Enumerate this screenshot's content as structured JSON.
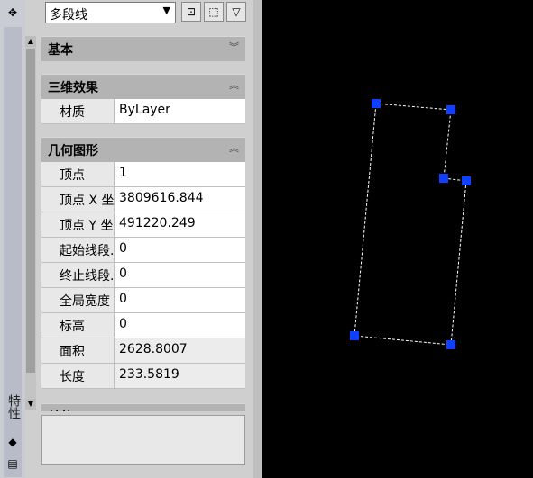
{
  "palette": {
    "vertical_title": "特性",
    "object_type": "多段线",
    "sections": {
      "basic": {
        "title": "基本"
      },
      "effects3d": {
        "title": "三维效果",
        "rows": [
          {
            "label": "材质",
            "value": "ByLayer"
          }
        ]
      },
      "geometry": {
        "title": "几何图形",
        "rows": [
          {
            "label": "顶点",
            "value": "1"
          },
          {
            "label": "顶点 X 坐标",
            "value": "3809616.844"
          },
          {
            "label": "顶点 Y 坐标",
            "value": "491220.249"
          },
          {
            "label": "起始线段...",
            "value": "0"
          },
          {
            "label": "终止线段...",
            "value": "0"
          },
          {
            "label": "全局宽度",
            "value": "0"
          },
          {
            "label": "标高",
            "value": "0"
          },
          {
            "label": "面积",
            "value": "2628.8007"
          },
          {
            "label": "长度",
            "value": "233.5819"
          }
        ]
      },
      "other": {
        "title": "其他"
      }
    }
  },
  "icons": {
    "quick_select": "quick-select-icon",
    "select_objects": "select-objects-icon",
    "toggle_pickadd": "pickadd-filter-icon"
  },
  "colors": {
    "grip": "#1040ff",
    "canvas_bg": "#000000",
    "polyline": "#ffffff"
  }
}
